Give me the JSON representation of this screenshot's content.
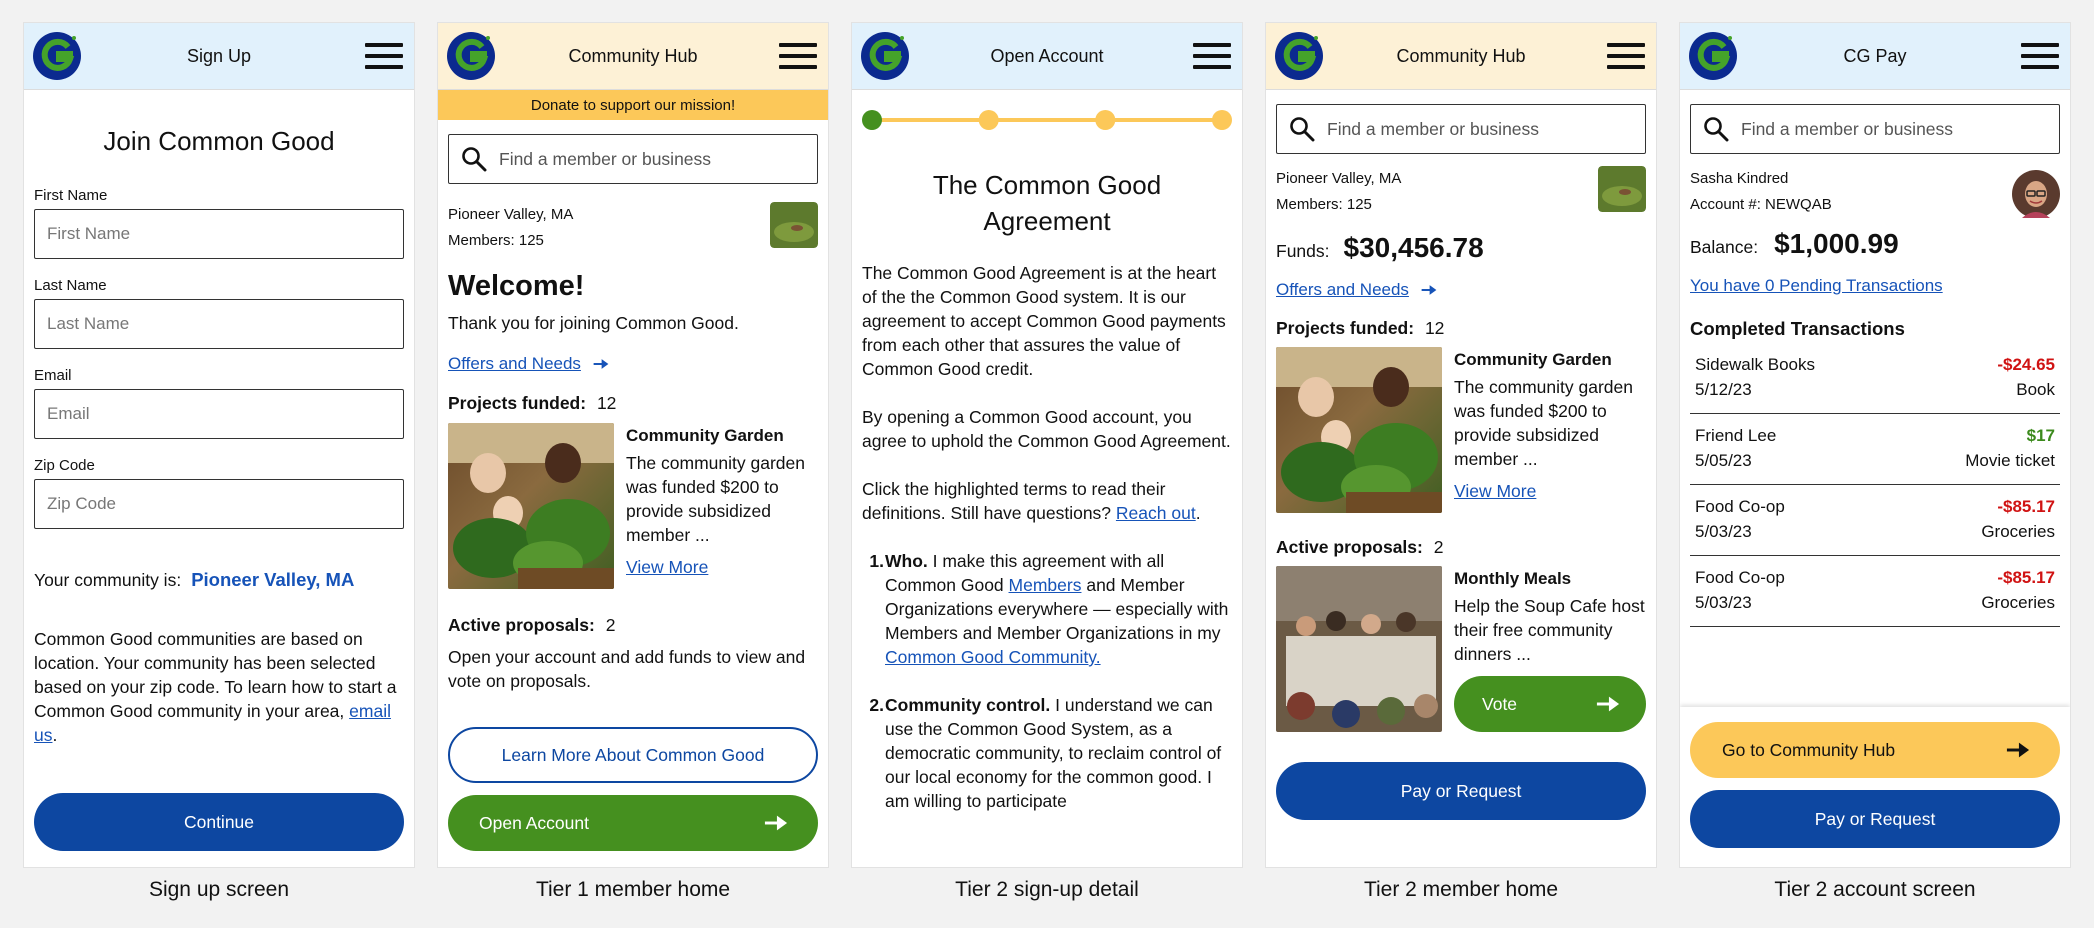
{
  "colors": {
    "brand_blue": "#0d47a1",
    "brand_green": "#45901f",
    "brand_yellow": "#fcc859",
    "header_blue": "#e1f1fc",
    "header_cream": "#fdf1d6",
    "link": "#1653b8",
    "negative": "#d01313",
    "positive": "#3c8a1d"
  },
  "icons": {
    "logo": "common-good-logo-icon",
    "menu": "hamburger-menu-icon",
    "search": "search-icon",
    "arrow": "arrow-right-icon"
  },
  "screens": {
    "signup": {
      "caption": "Sign up screen",
      "header_title": "Sign Up",
      "heading": "Join Common Good",
      "fields": [
        {
          "label": "First Name",
          "placeholder": "First Name"
        },
        {
          "label": "Last Name",
          "placeholder": "Last Name"
        },
        {
          "label": "Email",
          "placeholder": "Email"
        },
        {
          "label": "Zip Code",
          "placeholder": "Zip Code"
        }
      ],
      "community_label": "Your community is:",
      "community_value": "Pioneer Valley, MA",
      "info_text": "Common Good communities are based on location. Your community has been selected based on your zip code. To learn how to start a Common Good community in your area,",
      "info_link": "email us",
      "info_end": ".",
      "continue_label": "Continue"
    },
    "tier1": {
      "caption": "Tier 1 member home",
      "header_title": "Community Hub",
      "banner": "Donate to support our mission!",
      "search_placeholder": "Find a member or business",
      "location": "Pioneer Valley, MA",
      "members": "Members: 125",
      "welcome": "Welcome!",
      "thanks": "Thank you for joining Common Good.",
      "offers_link": "Offers and Needs",
      "projects_label": "Projects funded:",
      "projects_count": "12",
      "project_title": "Community Garden",
      "project_desc": "The community garden was funded $200 to provide subsidized member ...",
      "view_more": "View More",
      "proposals_label": "Active proposals:",
      "proposals_count": "2",
      "proposals_text": "Open your account and add funds to view and vote on proposals.",
      "learn_more_label": "Learn More About Common Good",
      "open_account_label": "Open Account"
    },
    "tier2signup": {
      "caption": "Tier 2 sign-up detail",
      "header_title": "Open Account",
      "progress_steps": 4,
      "progress_current": 1,
      "heading": "The Common Good Agreement",
      "para1": "The Common Good Agreement is at the heart of the the Common Good system. It is our agreement to accept Common Good payments from each other that assures the value of Common Good credit.",
      "para2": "By opening a Common Good account, you agree to uphold the Common Good Agreement.",
      "para3": "Click the highlighted terms to read their definitions. Still have questions?",
      "reach_out": "Reach out",
      "period": ".",
      "item1_num": "1.",
      "item1_bold": "Who.",
      "item1_a": " I make this agreement with all Common Good ",
      "item1_link1": "Members",
      "item1_b": " and Member Organizations everywhere — especially with Members and Member Organizations in my ",
      "item1_link2": "Common Good Community.",
      "item2_num": "2.",
      "item2_bold": "Community control.",
      "item2_text": " I understand we can use the Common Good System, as a democratic community, to reclaim control of our local economy for the common good. I am willing to participate"
    },
    "tier2home": {
      "caption": "Tier 2 member home",
      "header_title": "Community Hub",
      "search_placeholder": "Find a member or business",
      "location": "Pioneer Valley, MA",
      "members": "Members: 125",
      "funds_label": "Funds:",
      "funds_value": "$30,456.78",
      "offers_link": "Offers and Needs",
      "projects_label": "Projects funded:",
      "projects_count": "12",
      "project_title": "Community Garden",
      "project_desc": "The community garden was funded $200 to provide subsidized member ...",
      "view_more": "View More",
      "proposals_label": "Active proposals:",
      "proposals_count": "2",
      "proposal_title": "Monthly Meals",
      "proposal_desc": "Help the Soup Cafe host their free community dinners ...",
      "vote_label": "Vote",
      "pay_label": "Pay or Request"
    },
    "tier2account": {
      "caption": "Tier 2 account screen",
      "header_title": "CG Pay",
      "search_placeholder": "Find a member or business",
      "name": "Sasha Kindred",
      "account": "Account #: NEWQAB",
      "balance_label": "Balance:",
      "balance_value": "$1,000.99",
      "pending_link": "You have 0 Pending Transactions",
      "completed_title": "Completed Transactions",
      "transactions": [
        {
          "name": "Sidewalk Books",
          "date": "5/12/23",
          "amount": "-$24.65",
          "note": "Book",
          "sign": "neg"
        },
        {
          "name": "Friend Lee",
          "date": "5/05/23",
          "amount": "$17",
          "note": "Movie ticket",
          "sign": "pos"
        },
        {
          "name": "Food Co-op",
          "date": "5/03/23",
          "amount": "-$85.17",
          "note": "Groceries",
          "sign": "neg"
        },
        {
          "name": "Food Co-op",
          "date": "5/03/23",
          "amount": "-$85.17",
          "note": "Groceries",
          "sign": "neg"
        }
      ],
      "hub_label": "Go to Community Hub",
      "pay_label": "Pay or Request"
    }
  }
}
